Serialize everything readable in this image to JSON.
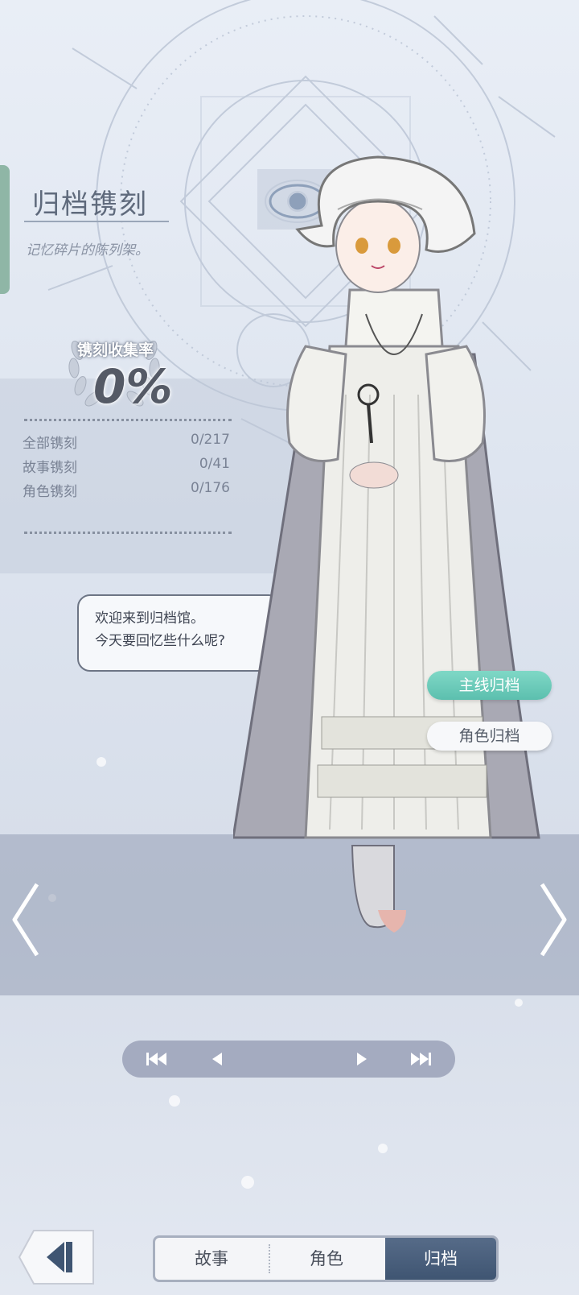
{
  "header": {
    "title": "归档镌刻",
    "subtitle": "记忆碎片的陈列架。"
  },
  "collection": {
    "rate_label": "镌刻收集率",
    "rate_value": "0%",
    "rows": [
      {
        "label": "全部镌刻",
        "value": "0/217"
      },
      {
        "label": "故事镌刻",
        "value": "0/41"
      },
      {
        "label": "角色镌刻",
        "value": "0/176"
      }
    ]
  },
  "dialogue": {
    "line1": "欢迎来到归档馆。",
    "line2": "今天要回忆些什么呢?"
  },
  "archive_buttons": {
    "main": "主线归档",
    "role": "角色归档"
  },
  "icons": {
    "prev_character": "chevron-left-icon",
    "next_character": "chevron-right-icon",
    "skip_back": "skip-back-icon",
    "step_back": "play-reverse-icon",
    "step_forward": "play-icon",
    "skip_forward": "skip-forward-icon",
    "back": "back-arrow-icon"
  },
  "tabs": [
    {
      "label": "故事",
      "active": false
    },
    {
      "label": "角色",
      "active": false
    },
    {
      "label": "归档",
      "active": true
    }
  ],
  "colors": {
    "accent_teal": "#5cbfae",
    "active_tab": "#3f5572",
    "text_dark": "#4a505c"
  }
}
